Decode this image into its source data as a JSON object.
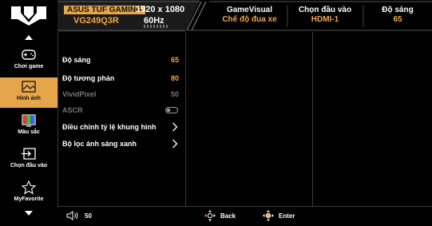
{
  "header": {
    "brand": "ASUS TUF GAMING",
    "model": "VG249Q3R",
    "resolution": "1920 x 1080",
    "refresh_rate": "60Hz",
    "game_visual_label": "GameVisual",
    "game_visual_value": "Chế độ đua xe",
    "input_label": "Chọn đầu vào",
    "input_value": "HDMI-1",
    "brightness_label": "Độ sáng",
    "brightness_value": "65"
  },
  "sidebar": {
    "items": [
      {
        "label": "Chơi game",
        "icon": "gamepad-icon"
      },
      {
        "label": "Hình ảnh",
        "icon": "image-icon"
      },
      {
        "label": "Màu sắc",
        "icon": "color-bars-icon"
      },
      {
        "label": "Chọn đầu vào",
        "icon": "input-arrow-icon"
      },
      {
        "label": "MyFavorite",
        "icon": "star-icon"
      }
    ],
    "active_index": 1
  },
  "menu": {
    "items": [
      {
        "label": "Độ sáng",
        "value": "65"
      },
      {
        "label": "Độ tương phản",
        "value": "80"
      },
      {
        "label": "VividPixel",
        "value": "50"
      },
      {
        "label": "ASCR",
        "value": ""
      },
      {
        "label": "Điều chỉnh tỷ lệ khung hình",
        "value": ""
      },
      {
        "label": "Bộ lọc ánh sáng xanh",
        "value": ""
      }
    ]
  },
  "footer": {
    "volume_value": "50",
    "back_label": "Back",
    "enter_label": "Enter"
  },
  "colors": {
    "accent": "#e5a64b",
    "value_text": "#f0a84d",
    "background": "#000000",
    "divider": "#3a3a3a",
    "disabled_text": "#777777"
  }
}
